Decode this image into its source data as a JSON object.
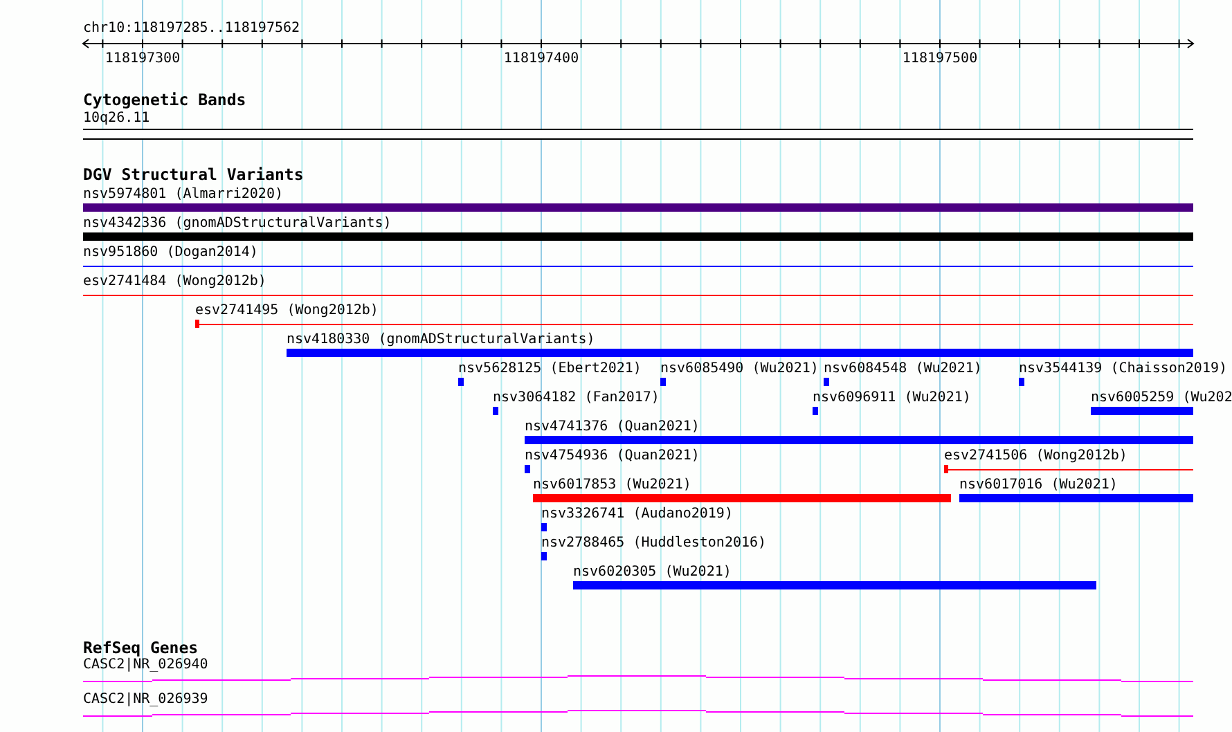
{
  "ruler": {
    "location": "chr10:118197285..118197562",
    "tick_labels": [
      "118197300",
      "118197400",
      "118197500"
    ]
  },
  "cytogenetic_bands": {
    "title": "Cytogenetic Bands",
    "band": "10q26.11"
  },
  "structural_variants": {
    "title": "DGV Structural Variants",
    "features": [
      {
        "label": "nsv5974801 (Almarri2020)",
        "color": "#4b0082",
        "kind": "bar"
      },
      {
        "label": "nsv4342336 (gnomADStructuralVariants)",
        "color": "#000000",
        "kind": "bar"
      },
      {
        "label": "nsv951860 (Dogan2014)",
        "color": "#0000ff",
        "kind": "line"
      },
      {
        "label": "esv2741484 (Wong2012b)",
        "color": "#ff0000",
        "kind": "line"
      },
      {
        "label": "esv2741495 (Wong2012b)",
        "color": "#ff0000",
        "kind": "marker-line"
      },
      {
        "label": "nsv4180330 (gnomADStructuralVariants)",
        "color": "#0000ff",
        "kind": "bar"
      },
      {
        "label": "nsv5628125 (Ebert2021)",
        "color": "#0000ff",
        "kind": "bar"
      },
      {
        "label": "nsv6085490 (Wu2021)",
        "color": "#0000ff",
        "kind": "bar"
      },
      {
        "label": "nsv6084548 (Wu2021)",
        "color": "#0000ff",
        "kind": "bar"
      },
      {
        "label": "nsv3544139 (Chaisson2019)",
        "color": "#0000ff",
        "kind": "bar"
      },
      {
        "label": "nsv3064182 (Fan2017)",
        "color": "#0000ff",
        "kind": "bar"
      },
      {
        "label": "nsv6096911 (Wu2021)",
        "color": "#0000ff",
        "kind": "bar"
      },
      {
        "label": "nsv6005259 (Wu202",
        "color": "#0000ff",
        "kind": "bar"
      },
      {
        "label": "nsv4741376 (Quan2021)",
        "color": "#0000ff",
        "kind": "bar"
      },
      {
        "label": "nsv4754936 (Quan2021)",
        "color": "#0000ff",
        "kind": "bar"
      },
      {
        "label": "esv2741506 (Wong2012b)",
        "color": "#ff0000",
        "kind": "marker-line"
      },
      {
        "label": "nsv6017853 (Wu2021)",
        "color": "#ff0000",
        "kind": "bar"
      },
      {
        "label": "nsv6017016 (Wu2021)",
        "color": "#0000ff",
        "kind": "bar"
      },
      {
        "label": "nsv3326741 (Audano2019)",
        "color": "#0000ff",
        "kind": "bar"
      },
      {
        "label": "nsv2788465 (Huddleston2016)",
        "color": "#0000ff",
        "kind": "bar"
      },
      {
        "label": "nsv6020305 (Wu2021)",
        "color": "#0000ff",
        "kind": "bar"
      }
    ]
  },
  "refseq_genes": {
    "title": "RefSeq Genes",
    "genes": [
      {
        "label": "CASC2|NR_026940"
      },
      {
        "label": "CASC2|NR_026939"
      }
    ]
  }
}
